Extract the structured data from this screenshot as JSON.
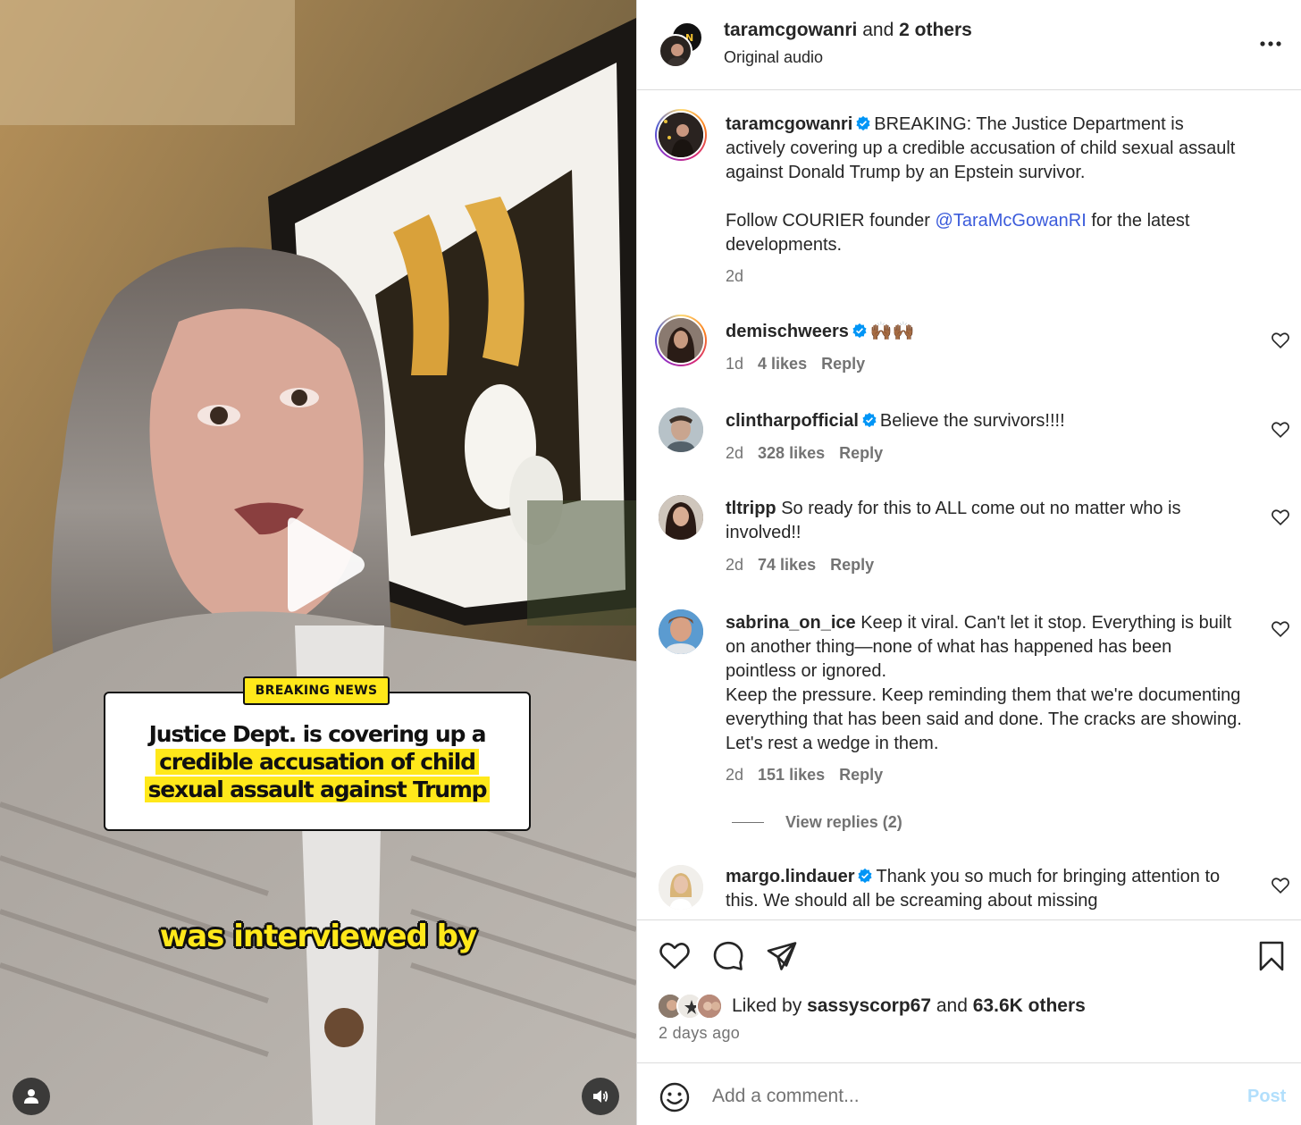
{
  "video": {
    "breaking_tag": "BREAKING NEWS",
    "headline_line1": "Justice Dept. is covering up a",
    "headline_line2": "credible accusation of child",
    "headline_line3": "sexual assault against Trump",
    "caption": "was interviewed by",
    "icons": [
      "play-icon",
      "user-tag-icon",
      "audio-icon"
    ]
  },
  "header": {
    "account": "taramcgowanri",
    "and_text": "and",
    "others": "2 others",
    "subtitle": "Original audio",
    "more_icon": "more-horizontal-icon"
  },
  "post": {
    "username": "taramcgowanri",
    "caption_part1": "BREAKING: The Justice Department is actively covering up a credible accusation of child sexual assault against Donald Trump by an Epstein survivor.",
    "caption_part2_prefix": "Follow COURIER founder ",
    "caption_mention": "@TaraMcGowanRI",
    "caption_part2_suffix": " for the latest developments.",
    "time": "2d"
  },
  "comments": [
    {
      "username": "demischweers",
      "verified": true,
      "text": "🙌🏾🙌🏾",
      "time": "1d",
      "likes": "4 likes",
      "reply": "Reply"
    },
    {
      "username": "clintharpofficial",
      "verified": true,
      "text": "Believe the survivors!!!!",
      "time": "2d",
      "likes": "328 likes",
      "reply": "Reply"
    },
    {
      "username": "tltripp",
      "verified": false,
      "text": "So ready for this to ALL come out no matter who is involved!!",
      "time": "2d",
      "likes": "74 likes",
      "reply": "Reply"
    },
    {
      "username": "sabrina_on_ice",
      "verified": false,
      "text": "Keep it viral. Can't let it stop. Everything is built on another thing—none of what has happened has been pointless or ignored.",
      "text2": "Keep the pressure. Keep reminding them that we're documenting everything that has been said and done. The cracks are showing. Let's rest a wedge in them.",
      "time": "2d",
      "likes": "151 likes",
      "reply": "Reply",
      "view_replies": "View replies (2)"
    },
    {
      "username": "margo.lindauer",
      "verified": true,
      "text": "Thank you so much for bringing attention to this. We should all be screaming about missing"
    }
  ],
  "actions": {
    "icons": [
      "heart-icon",
      "comment-icon",
      "share-icon",
      "bookmark-icon"
    ],
    "liked_by_prefix": "Liked by",
    "liked_by_user": "sassyscorp67",
    "liked_by_and": "and",
    "liked_by_count": "63.6K others",
    "time_ago": "2 days ago"
  },
  "add_comment": {
    "placeholder": "Add a comment...",
    "post_label": "Post",
    "emoji_icon": "emoji-icon"
  },
  "colors": {
    "accent_blue": "#0095f6",
    "post_disabled": "#b2dffc",
    "highlight_yellow": "#ffe81a",
    "verified_blue": "#0095f6"
  }
}
